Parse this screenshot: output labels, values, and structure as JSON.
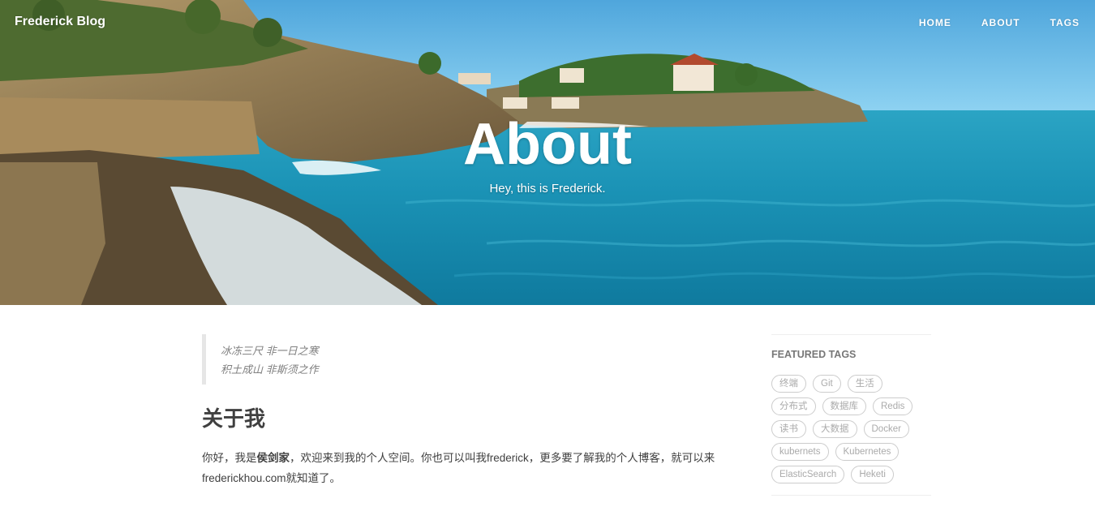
{
  "site": {
    "brand": "Frederick Blog",
    "nav": [
      {
        "label": "HOME"
      },
      {
        "label": "ABOUT"
      },
      {
        "label": "TAGS"
      }
    ]
  },
  "hero": {
    "title": "About",
    "subtitle": "Hey, this is Frederick."
  },
  "post": {
    "quote_lines": [
      "冰冻三尺 非一日之寒",
      "积土成山 非斯须之作"
    ],
    "heading": "关于我",
    "intro_prefix": "你好，我是",
    "intro_name": "侯剑家",
    "intro_suffix": "，欢迎来到我的个人空间。你也可以叫我frederick，更多要了解我的个人博客，就可以来frederickhou.com就知道了。"
  },
  "sidebar": {
    "featured_title": "FEATURED TAGS",
    "tags": [
      "终端",
      "Git",
      "生活",
      "分布式",
      "数据库",
      "Redis",
      "读书",
      "大数据",
      "Docker",
      "kubernets",
      "Kubernetes",
      "ElasticSearch",
      "Heketi"
    ]
  },
  "colors": {
    "sea": "#1a8fb3",
    "sky": "#7cc8ef",
    "text": "#404040",
    "muted": "#808080",
    "tag_border": "#cccccc"
  }
}
